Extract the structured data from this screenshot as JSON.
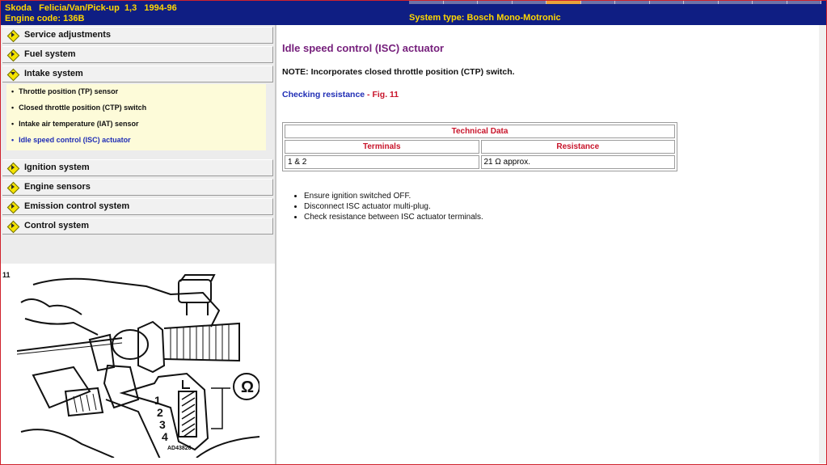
{
  "header": {
    "line1": "Skoda   Felicia/Van/Pick-up  1,3   1994-96",
    "line2": "Engine code: 136B",
    "system_type": "System type: Bosch Mono-Motronic"
  },
  "nav": {
    "items": [
      {
        "label": "Service adjustments"
      },
      {
        "label": "Fuel system"
      },
      {
        "label": "Intake system"
      },
      {
        "label": "Ignition system"
      },
      {
        "label": "Engine sensors"
      },
      {
        "label": "Emission control system"
      },
      {
        "label": "Control system"
      }
    ],
    "intake_sub": [
      {
        "label": "Throttle position (TP) sensor"
      },
      {
        "label": "Closed throttle position (CTP) switch"
      },
      {
        "label": "Intake air temperature (IAT) sensor"
      },
      {
        "label": "Idle speed control (ISC) actuator"
      }
    ]
  },
  "figure": {
    "number": "11",
    "labels": [
      "1",
      "2",
      "3",
      "4"
    ],
    "code": "AD43826",
    "symbol": "Ω"
  },
  "main": {
    "title": "Idle speed control (ISC) actuator",
    "note": "NOTE: Incorporates closed throttle position (CTP) switch.",
    "checking_text": "Checking resistance",
    "checking_fig": " - Fig. 11",
    "table": {
      "caption": "Technical Data",
      "headers": [
        "Terminals",
        "Resistance"
      ],
      "rows": [
        [
          "1 & 2",
          "21 Ω approx."
        ]
      ]
    },
    "steps": [
      "Ensure ignition switched OFF.",
      "Disconnect ISC actuator multi-plug.",
      "Check resistance between ISC actuator terminals."
    ]
  },
  "colors": {
    "header_bg": "#0f1e83",
    "header_text": "#ffd700",
    "title": "#76207c",
    "link": "#1f2db5",
    "accent_red": "#c8152b",
    "submenu_bg": "#fdfbd9"
  }
}
